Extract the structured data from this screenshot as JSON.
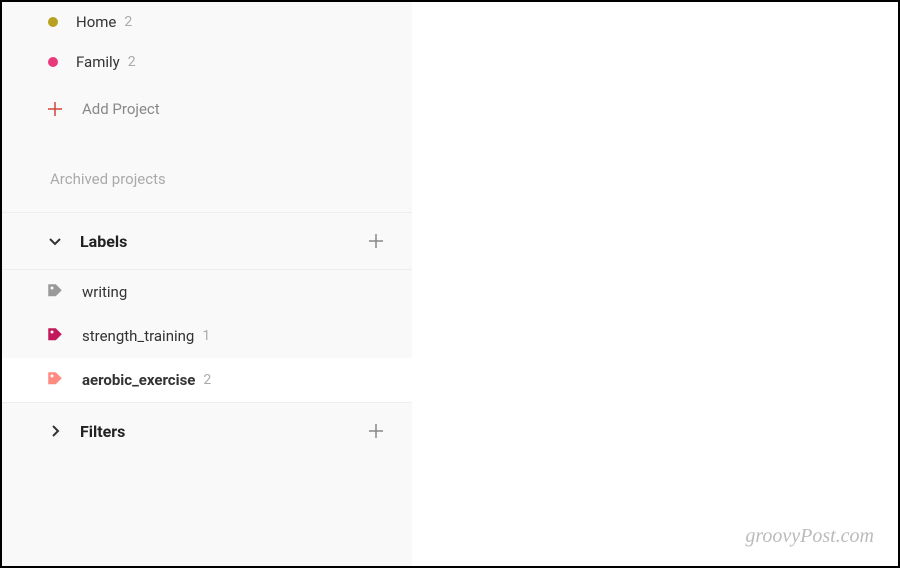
{
  "projects": [
    {
      "name": "Home",
      "count": "2",
      "color": "#b8a020"
    },
    {
      "name": "Family",
      "count": "2",
      "color": "#e8397a"
    }
  ],
  "add_project_label": "Add Project",
  "archived_label": "Archived projects",
  "sections": {
    "labels": {
      "title": "Labels"
    },
    "filters": {
      "title": "Filters"
    }
  },
  "labels": [
    {
      "name": "writing",
      "count": "",
      "color": "#999999",
      "selected": false
    },
    {
      "name": "strength_training",
      "count": "1",
      "color": "#c2185b",
      "selected": false
    },
    {
      "name": "aerobic_exercise",
      "count": "2",
      "color": "#ff8a80",
      "selected": true
    }
  ],
  "watermark": "groovyPost.com"
}
